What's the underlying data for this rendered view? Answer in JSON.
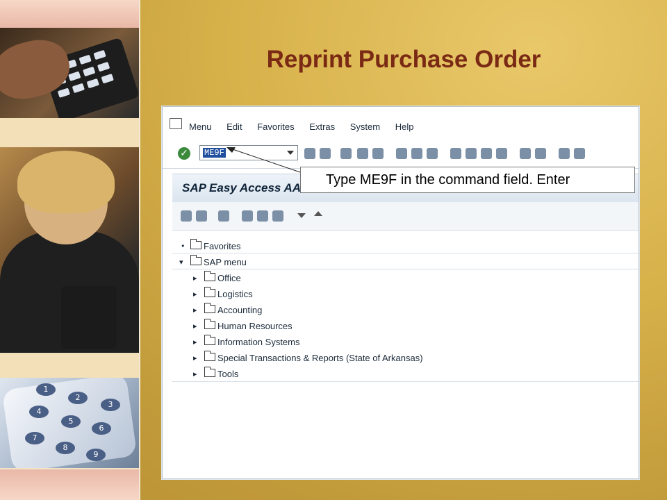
{
  "slide": {
    "title": "Reprint Purchase Order"
  },
  "sap": {
    "menubar": {
      "items": [
        "Menu",
        "Edit",
        "Favorites",
        "Extras",
        "System",
        "Help"
      ]
    },
    "command_field": {
      "value": "ME9F"
    },
    "easy_access_title": "SAP Easy Access  AA",
    "tree": {
      "items": [
        {
          "label": "Favorites",
          "level": 0,
          "marker": "•"
        },
        {
          "label": "SAP menu",
          "level": 0,
          "marker": "▾"
        },
        {
          "label": "Office",
          "level": 1,
          "marker": "▸"
        },
        {
          "label": "Logistics",
          "level": 1,
          "marker": "▸"
        },
        {
          "label": "Accounting",
          "level": 1,
          "marker": "▸"
        },
        {
          "label": "Human Resources",
          "level": 1,
          "marker": "▸"
        },
        {
          "label": "Information Systems",
          "level": 1,
          "marker": "▸"
        },
        {
          "label": "Special Transactions & Reports (State of Arkansas)",
          "level": 1,
          "marker": "▸"
        },
        {
          "label": "Tools",
          "level": 1,
          "marker": "▸"
        }
      ]
    }
  },
  "callout": {
    "text": "Type ME9F in the command field. Enter"
  },
  "colors": {
    "title": "#7a2a14",
    "sap_selection": "#1f4f9e",
    "background": "#d7b14a"
  },
  "icons": {
    "ok": "check-icon",
    "folder": "folder-icon",
    "dropdown": "chevron-down-icon"
  }
}
